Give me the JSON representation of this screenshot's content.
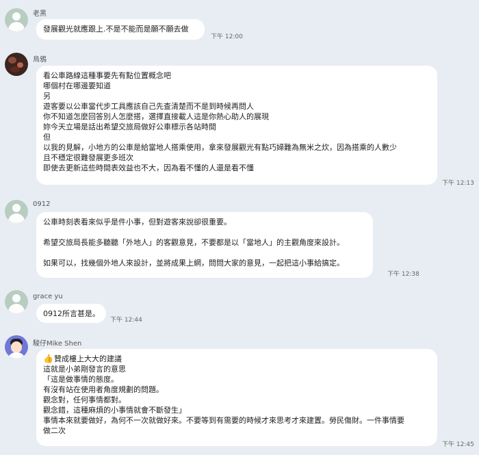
{
  "messages": [
    {
      "name": "老黑",
      "lines": [
        "發展觀光就應跟上.不是不能而是願不願去做"
      ],
      "time": "下午 12:00"
    },
    {
      "name": "烏鴉",
      "lines": [
        "看公車路線這種事要先有點位置概念吧",
        "哪個村在哪邊要知道",
        "另",
        "遊客要以公車當代步工具應該自己先查清楚而不是到時候再問人",
        "你不知道怎麼回答別人怎麼搭，選擇直接載人這是你熱心助人的展現",
        "妳今天立場是話出希望交旅局做好公車標示各站時間",
        "但",
        "以我的見解，小地方的公車是給當地人搭乘使用，拿來發展觀光有點巧婦難為無米之炊，因為搭乘的人數少",
        "且不穩定很難發展更多班次",
        "即使去更新這些時間表效益也不大，因為看不懂的人還是看不懂"
      ],
      "time": "下午 12:13"
    },
    {
      "name": "0912",
      "lines": [
        "公車時刻表看來似乎是件小事，但對遊客來說卻很重要。",
        "",
        "希望交旅局長能多聽聽「外地人」的客觀意見，不要都是以「當地人」的主觀角度來設計。",
        "",
        "如果可以，找幾個外地人來設計，並將成果上網，問問大家的意見，一起把這小事給搞定。"
      ],
      "time": "下午 12:38"
    },
    {
      "name": "grace yu",
      "lines": [
        "0912所言甚是。"
      ],
      "time": "下午 12:44"
    },
    {
      "name": "駿仔Mike Shen",
      "lines": [
        "贊成樓上大大的建議",
        "這就是小弟剛發言的意思",
        "「這是做事情的態度。",
        "有沒有站在使用者角度規劃的問題。",
        "觀念對，任何事情都對。",
        "觀念錯，這種麻煩的小事情就會不斷發生」",
        "事情本來就要做好，為何不一次就做好來。不要等到有需要的時候才來思考才來建置。勞民傷財。一件事情要",
        "做二次"
      ],
      "time": "下午 12:45",
      "icon": "thumbs-up-icon"
    }
  ]
}
